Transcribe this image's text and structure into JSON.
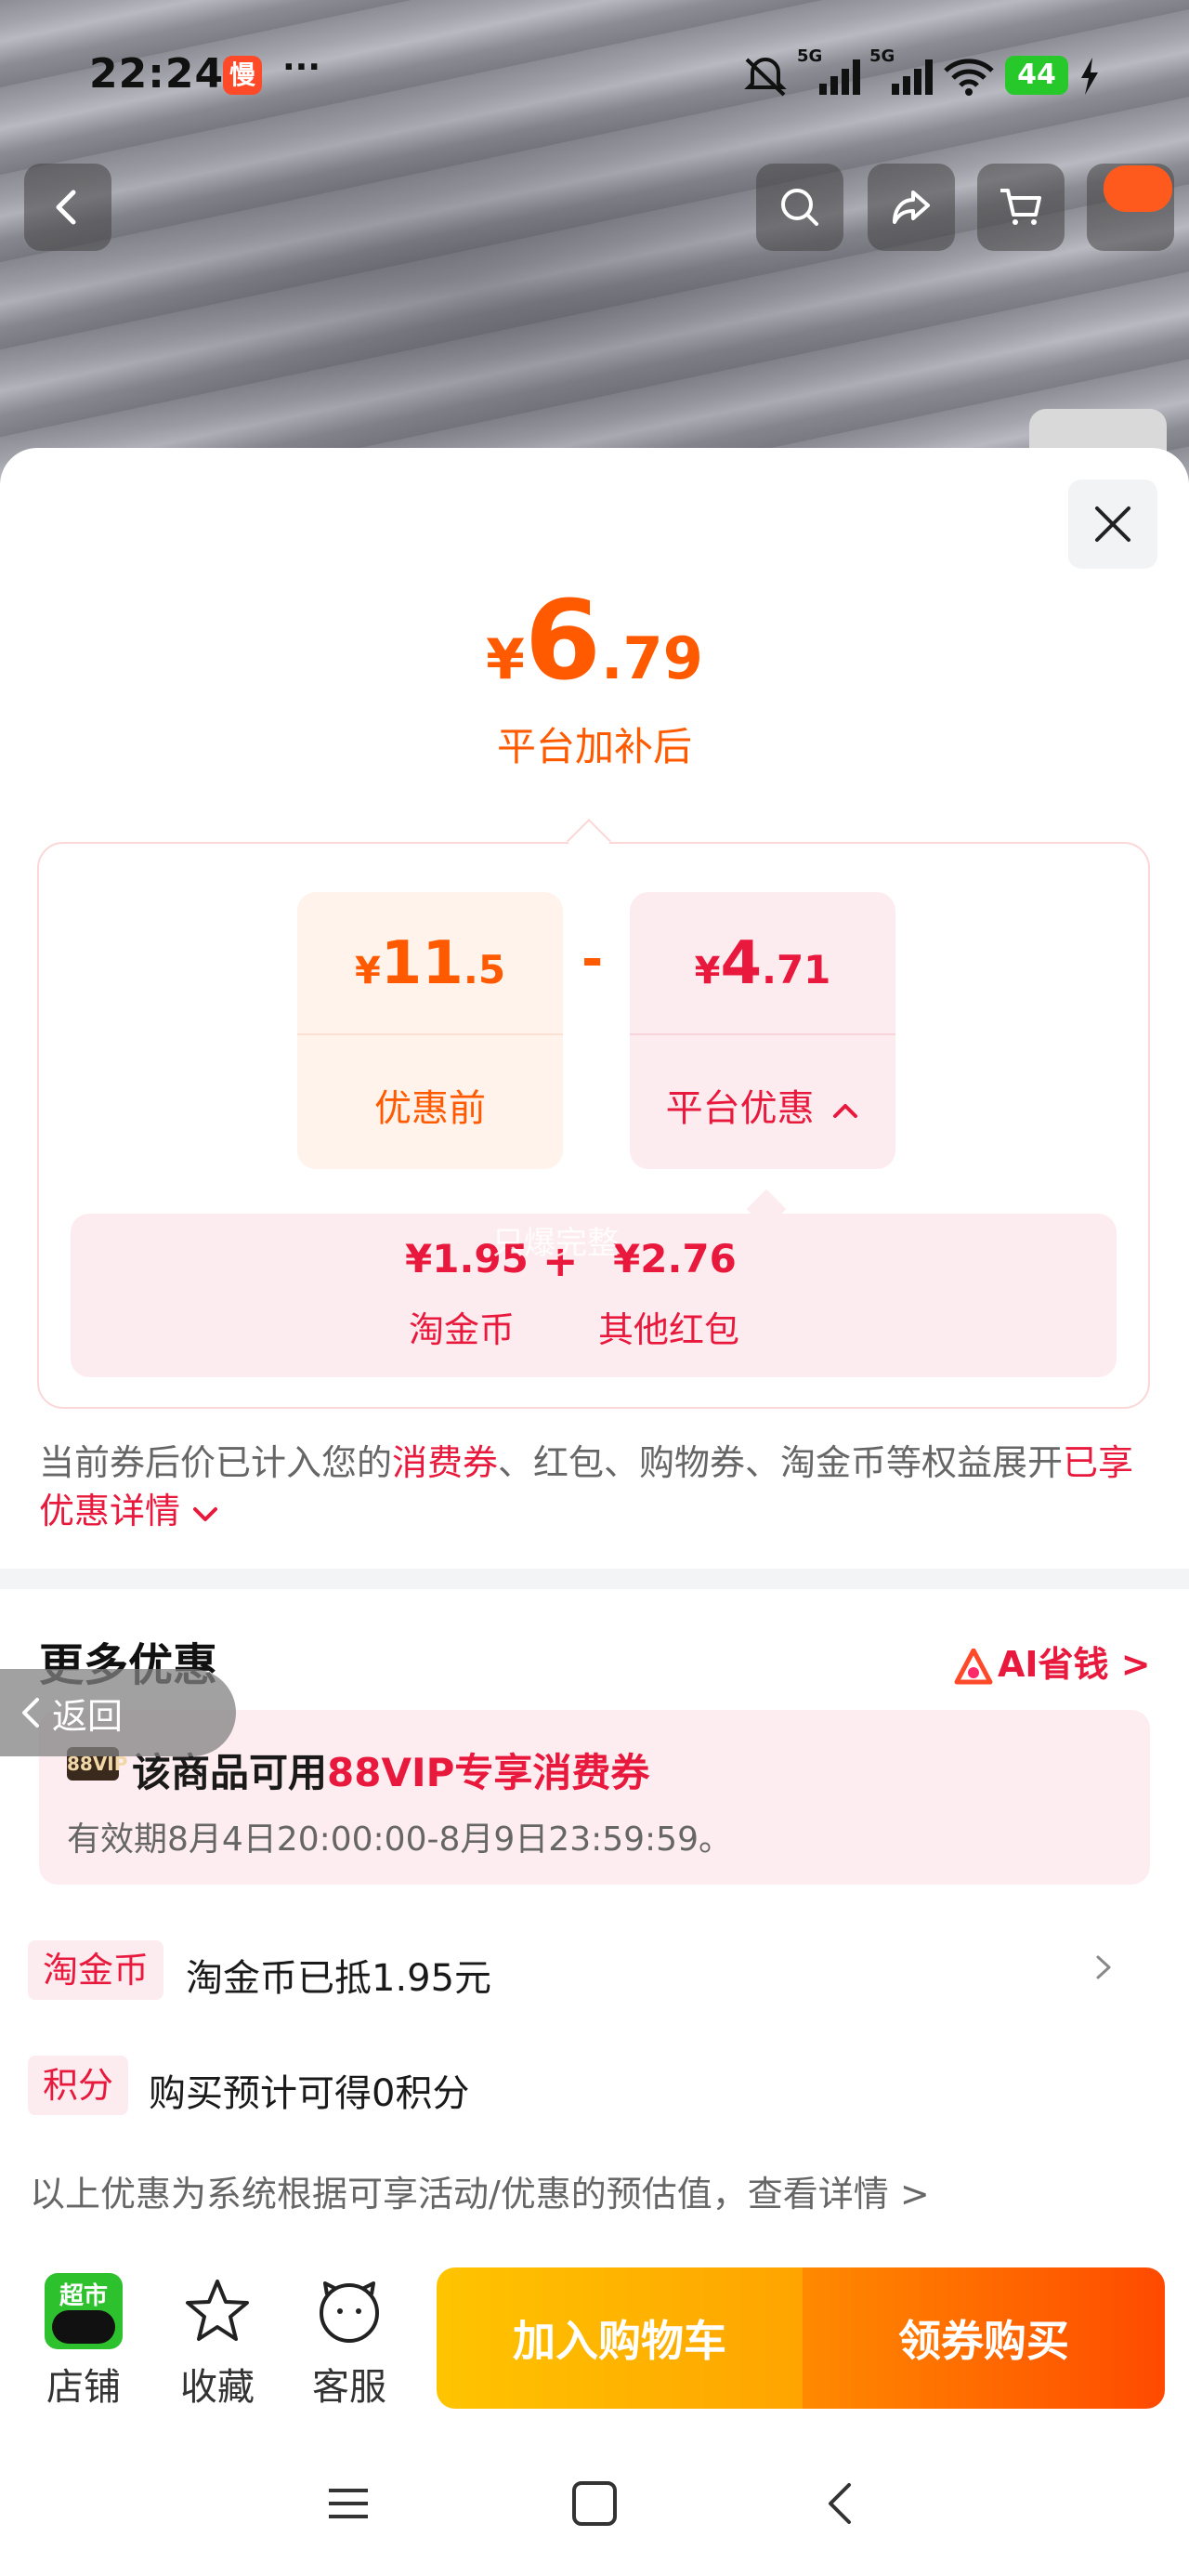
{
  "status_bar": {
    "time": "22:24",
    "app_badge": "慢",
    "more_dots": "···",
    "network_1": "5G",
    "network_2": "5G",
    "battery": "44"
  },
  "top_nav": {
    "back_icon": "chevron-left-icon",
    "search_icon": "search-icon",
    "share_icon": "share-icon",
    "cart_icon": "cart-icon"
  },
  "price": {
    "currency": "¥",
    "integer": "6",
    "decimal": ".79",
    "subtitle": "平台加补后"
  },
  "breakdown": {
    "before": {
      "currency": "¥",
      "integer": "11",
      "decimal": ".5",
      "label": "优惠前"
    },
    "operator": "-",
    "platform": {
      "currency": "¥",
      "integer": "4",
      "decimal": ".71",
      "label": "平台优惠"
    },
    "items": [
      {
        "amount": "¥1.95",
        "label": "淘金币"
      },
      {
        "amount": "¥2.76",
        "label": "其他红包"
      }
    ],
    "plus": "+",
    "watermark": "只爆完整"
  },
  "note": {
    "part1": "当前券后价已计入您的",
    "highlight1": "消费券",
    "part2": "、红包、购物券、淘金币等权益展开",
    "highlight2": "已享优惠详情"
  },
  "more": {
    "title": "更多优惠",
    "ai_link": "AI省钱 >",
    "back_label": "返回",
    "vip_tag": "88VIP",
    "vip_title_prefix": "该商品可用",
    "vip_title_highlight": "88VIP专享消费券",
    "vip_validity": "有效期8月4日20:00:00-8月9日23:59:59。",
    "rows": [
      {
        "tag": "淘金币",
        "text": "淘金币已抵1.95元"
      },
      {
        "tag": "积分",
        "text": "购买预计可得0积分"
      }
    ],
    "footer_note": "以上优惠为系统根据可享活动/优惠的预估值，查看详情 >"
  },
  "bottom_bar": {
    "store_badge": "超市",
    "store_label": "店铺",
    "favorite_label": "收藏",
    "service_label": "客服",
    "add_cart": "加入购物车",
    "buy": "领券购买"
  },
  "colors": {
    "orange": "#ff5a00",
    "red": "#e8193c",
    "pink_bg": "#fdecef"
  }
}
